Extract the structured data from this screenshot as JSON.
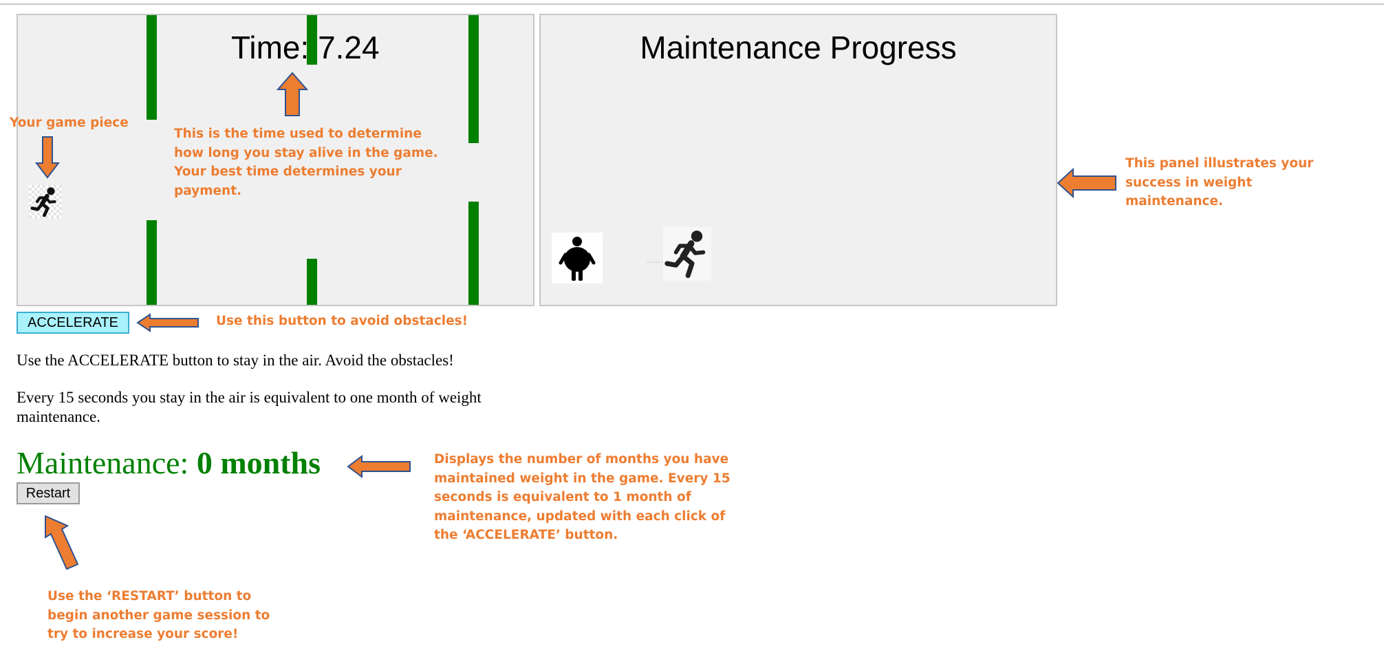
{
  "game": {
    "timer_label": "Time",
    "timer_value": "7.24",
    "timer_text": "Time: 7.24"
  },
  "maintenance_panel": {
    "title": "Maintenance Progress"
  },
  "controls": {
    "accelerate_label": "ACCELERATE",
    "restart_label": "Restart"
  },
  "instructions": {
    "line1": "Use the ACCELERATE button to stay in the air. Avoid the obstacles!",
    "line2": "Every 15 seconds you stay in the air is equivalent to one month of weight maintenance."
  },
  "maintenance": {
    "label": "Maintenance: ",
    "value": "0 months"
  },
  "annotations": {
    "game_piece": "Your game piece",
    "timer": "This is the time used to determine how long you stay alive in the game.  Your best time determines your payment.",
    "panel": "This panel illustrates your success in weight maintenance.",
    "accelerate": "Use this button to avoid obstacles!",
    "months": "Displays the number of months you have maintained weight in the game.  Every 15 seconds is equivalent to 1 month of maintenance, updated with each click of the ‘ACCELERATE’ button.",
    "restart": "Use the ‘RESTART’ button to begin another game session to try to increase your score!"
  },
  "colors": {
    "obstacle": "#008000",
    "annotation_text": "#ed7d31",
    "arrow_fill": "#ed7d31",
    "arrow_stroke": "#2f528f",
    "maintenance_text": "#008000",
    "accelerate_bg": "#aaf2fb"
  },
  "icons": {
    "game_piece": "running-person-icon",
    "overweight_figure": "overweight-person-icon",
    "runner_figure": "running-person-icon"
  }
}
